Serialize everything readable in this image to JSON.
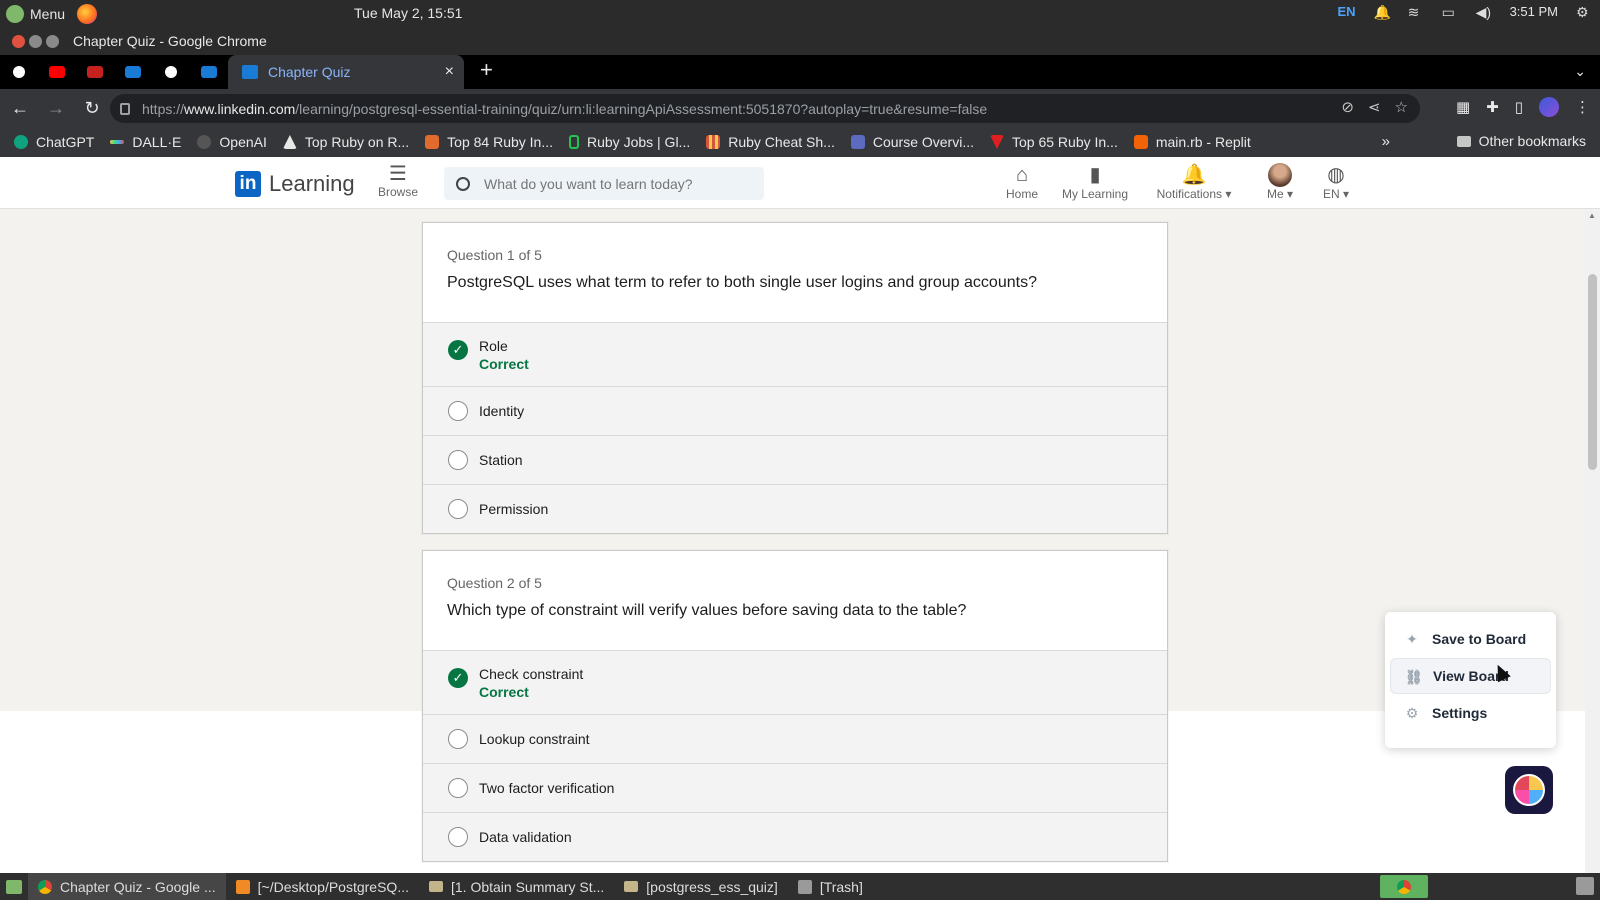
{
  "os": {
    "menu_label": "Menu",
    "datetime": "Tue May 2, 15:51",
    "lang": "EN",
    "time": "3:51 PM"
  },
  "window": {
    "title": "Chapter Quiz - Google Chrome"
  },
  "tabs": {
    "active_title": "Chapter Quiz",
    "close_glyph": "×",
    "new_tab_glyph": "+"
  },
  "address": {
    "host_prefix": "https://",
    "host": "www.linkedin.com",
    "path": "/learning/postgresql-essential-training/quiz/urn:li:learningApiAssessment:5051870?autoplay=true&resume=false"
  },
  "bookmarks": {
    "items": [
      {
        "label": "ChatGPT",
        "color": "#10a37f"
      },
      {
        "label": "DALL·E",
        "color": "#f2c94c"
      },
      {
        "label": "OpenAI",
        "color": "#555555"
      },
      {
        "label": "Top Ruby on R...",
        "color": "#e8e8e8"
      },
      {
        "label": "Top 84 Ruby In...",
        "color": "#e06b2c"
      },
      {
        "label": "Ruby Jobs | Gl...",
        "color": "#23c552"
      },
      {
        "label": "Ruby Cheat Sh...",
        "color": "#d4563c"
      },
      {
        "label": "Course Overvi...",
        "color": "#5c6bc0"
      },
      {
        "label": "Top 65 Ruby In...",
        "color": "#e02020"
      },
      {
        "label": "main.rb - Replit",
        "color": "#f26207"
      }
    ],
    "more_glyph": "»",
    "other_label": "Other bookmarks"
  },
  "linkedin": {
    "logo_in": "in",
    "logo_text": "Learning",
    "browse_label": "Browse",
    "search_placeholder": "What do you want to learn today?",
    "nav": {
      "home": "Home",
      "my_learning": "My Learning",
      "notifications": "Notifications ▾",
      "me": "Me ▾",
      "lang": "EN ▾"
    }
  },
  "quiz": {
    "questions": [
      {
        "number": "Question 1 of 5",
        "text": "PostgreSQL uses what term to refer to both single user logins and group accounts?",
        "options": [
          {
            "label": "Role",
            "status": "Correct"
          },
          {
            "label": "Identity"
          },
          {
            "label": "Station"
          },
          {
            "label": "Permission"
          }
        ]
      },
      {
        "number": "Question 2 of 5",
        "text": "Which type of constraint will verify values before saving data to the table?",
        "options": [
          {
            "label": "Check constraint",
            "status": "Correct"
          },
          {
            "label": "Lookup constraint"
          },
          {
            "label": "Two factor verification"
          },
          {
            "label": "Data validation"
          }
        ]
      }
    ]
  },
  "popup": {
    "save": "Save to Board",
    "view": "View Board",
    "settings": "Settings"
  },
  "taskbar": {
    "items": [
      "Chapter Quiz - Google ...",
      "[~/Desktop/PostgreSQ...",
      "[1. Obtain Summary St...",
      "[postgress_ess_quiz]",
      "[Trash]"
    ]
  },
  "colors": {
    "linkedin_blue": "#0a66c2",
    "correct_green": "#057642"
  }
}
